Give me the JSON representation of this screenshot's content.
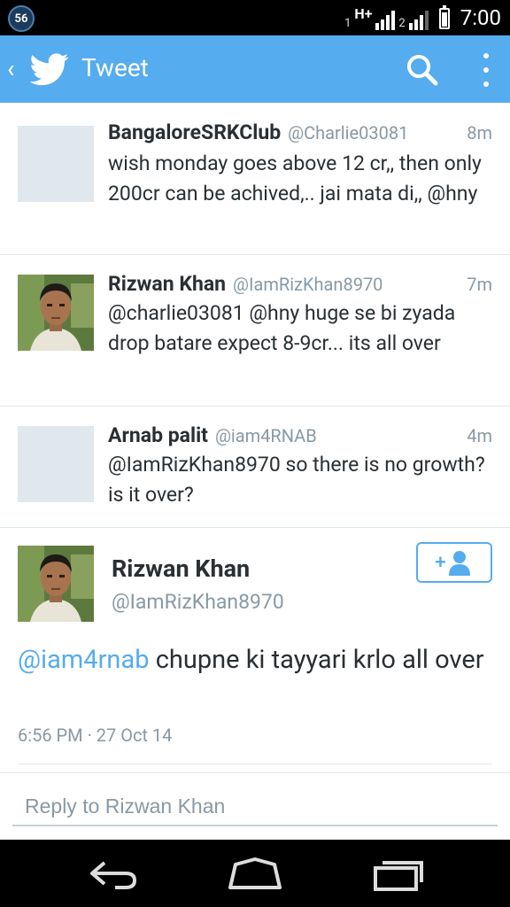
{
  "status_bar": {
    "notification_count": "56",
    "sim1": "1",
    "network_type": "H+",
    "sim2": "2",
    "time": "7:00"
  },
  "action_bar": {
    "title": "Tweet",
    "back_icon": "back-chevron-icon",
    "logo_icon": "twitter-bird-icon",
    "search_icon": "search-icon",
    "menu_icon": "overflow-menu-icon",
    "background_color": "#55acee"
  },
  "tweets": [
    {
      "name": "BangaloreSRKClub",
      "handle": "@Charlie03081",
      "time": "8m",
      "text": "wish monday goes above 12 cr,, then only 200cr can be achived,.. jai mata di,, @hny"
    },
    {
      "name": "Rizwan Khan",
      "handle": "@IamRizKhan8970",
      "time": "7m",
      "text": "@charlie03081 @hny huge se bi zyada drop batare expect 8-9cr... its all over"
    },
    {
      "name": "Arnab palit",
      "handle": "@iam4RNAB",
      "time": "4m",
      "text": "@IamRizKhan8970 so there is no growth?is it over?"
    }
  ],
  "detail": {
    "name": "Rizwan Khan",
    "handle": "@IamRizKhan8970",
    "mention": "@iam4rnab",
    "text": " chupne ki tayyari krlo all over",
    "timestamp": "6:56 PM · 27 Oct 14",
    "follow_icon": "add-user-icon"
  },
  "reply": {
    "placeholder": "Reply to Rizwan Khan"
  },
  "nav": {
    "back": "nav-back-icon",
    "home": "nav-home-icon",
    "recents": "nav-recents-icon"
  },
  "colors": {
    "accent": "#55acee",
    "muted_text": "#8899a6",
    "divider": "#e1e8ed"
  }
}
